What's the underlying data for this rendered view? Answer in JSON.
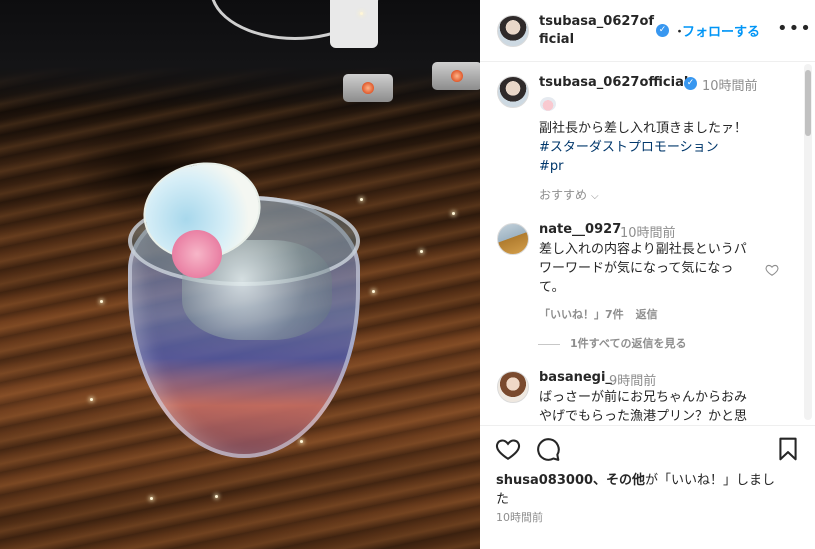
{
  "post": {
    "author": "tsubasa_0627official",
    "author_header_line1": "tsubasa_0627of",
    "author_header_line2": "ficial",
    "follow_label": "フォローする",
    "separator": "・",
    "more_label": "•••"
  },
  "caption": {
    "user": "tsubasa_0627official",
    "time": "10時間前",
    "text_line1": "副社長から差し入れ頂きましたァ！",
    "hashtag1": "#スターダストプロモーション",
    "hashtag2": "#pr"
  },
  "recommend": {
    "label": "おすすめ",
    "chevron": "⌵"
  },
  "comments": [
    {
      "user": "nate__0927",
      "time": "10時間前",
      "lines": [
        "差し入れの内容より副社長というパ",
        "ワーワードが気になって気になっ",
        "て。"
      ],
      "likes": "「いいね！」7件",
      "reply_label": "返信",
      "view_replies": "1件すべての返信を見る"
    },
    {
      "user": "basanegi_",
      "time": "9時間前",
      "lines": [
        "ばっさーが前にお兄ちゃんからおみ",
        "やげでもらった漁港プリン？かと思"
      ]
    }
  ],
  "likes_summary": {
    "users": "shusa083000",
    "rest_bold": "、その他",
    "suffix_line1": "が「いいね！」しまし",
    "suffix_line2": "た"
  },
  "posted_time": "10時間前",
  "icons": {
    "heart": "heart-icon",
    "comment": "comment-icon",
    "bookmark": "bookmark-icon",
    "verified": "verified-icon",
    "more": "more-icon"
  },
  "colors": {
    "link_blue": "#0095f6",
    "verified_blue": "#3897f0",
    "hashtag": "#00376b",
    "muted": "#8e8e8e"
  }
}
